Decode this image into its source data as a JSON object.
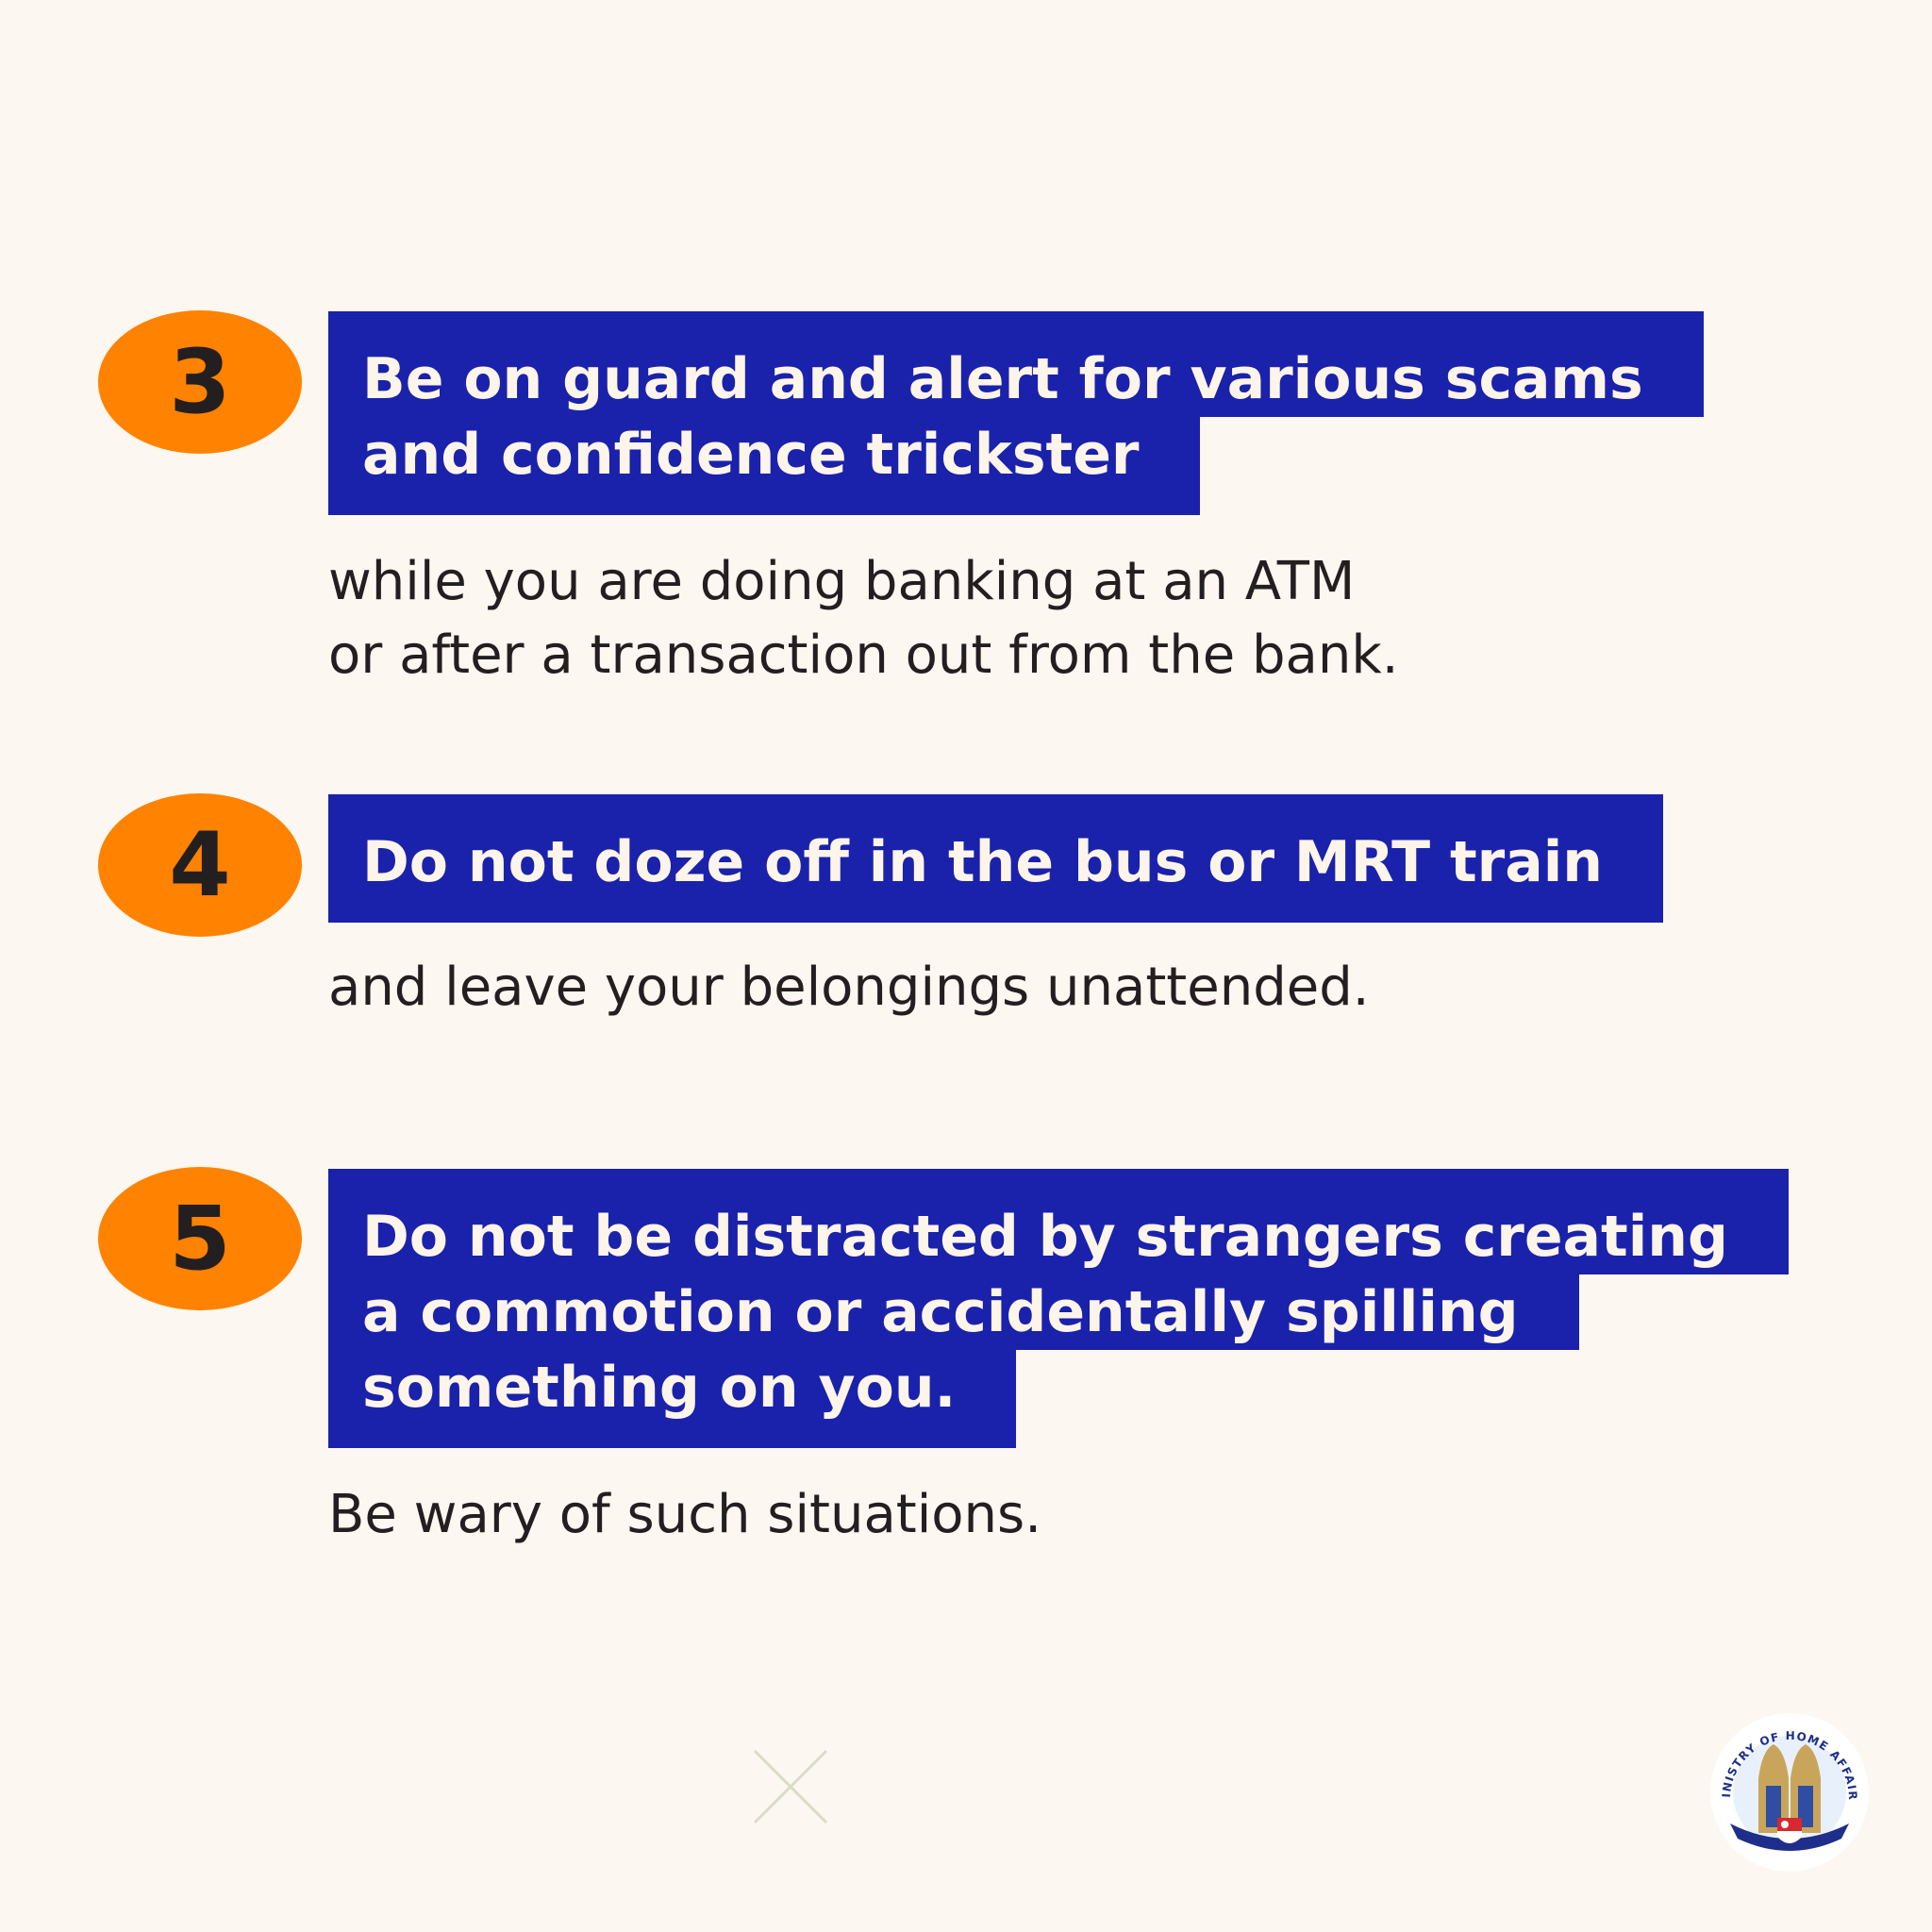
{
  "tips": [
    {
      "number": "3",
      "headline_lines": [
        "Be on guard and alert for various scams",
        "and confidence trickster"
      ],
      "body_lines": [
        "while you are doing banking at an ATM",
        "or after a transaction out from the bank."
      ]
    },
    {
      "number": "4",
      "headline_lines": [
        "Do not doze off in the bus or MRT train"
      ],
      "body_lines": [
        "and leave your belongings unattended."
      ]
    },
    {
      "number": "5",
      "headline_lines": [
        "Do not be distracted by strangers creating",
        "a commotion or accidentally spilling",
        "something on you."
      ],
      "body_lines": [
        "Be wary of such situations."
      ]
    }
  ],
  "logo": {
    "text": "MINISTRY OF HOME AFFAIRS"
  },
  "colors": {
    "background": "#fcf7f0",
    "badge": "#ff8200",
    "headline_bg": "#1a22ab",
    "headline_text": "#fdf4ea",
    "body_text": "#231f20"
  }
}
